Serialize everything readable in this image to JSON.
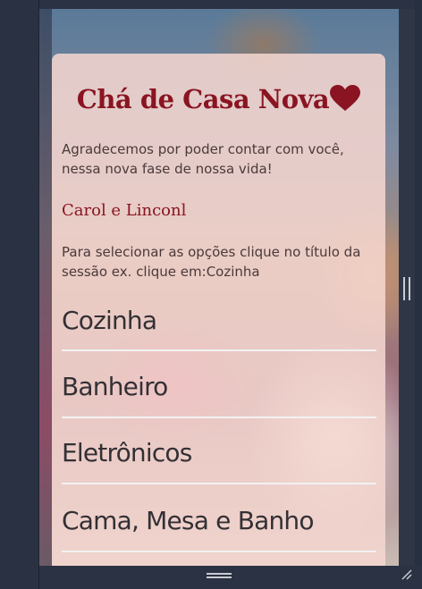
{
  "header": {
    "title": "Chá de Casa Nova",
    "title_icon": "heart-icon"
  },
  "intro": "Agradecemos por poder contar com você, nessa nova fase de nossa vida!",
  "signature": "Carol e Linconl",
  "instructions": "Para selecionar as opções clique no título da sessão ex. clique em:Cozinha",
  "sections": [
    {
      "label": "Cozinha"
    },
    {
      "label": "Banheiro"
    },
    {
      "label": "Eletrônicos"
    },
    {
      "label": "Cama, Mesa e Banho"
    }
  ],
  "colors": {
    "accent": "#8a1422",
    "card_background": "#f6d7d0",
    "divider": "#f2f2f2",
    "chrome": "#2b3243"
  }
}
